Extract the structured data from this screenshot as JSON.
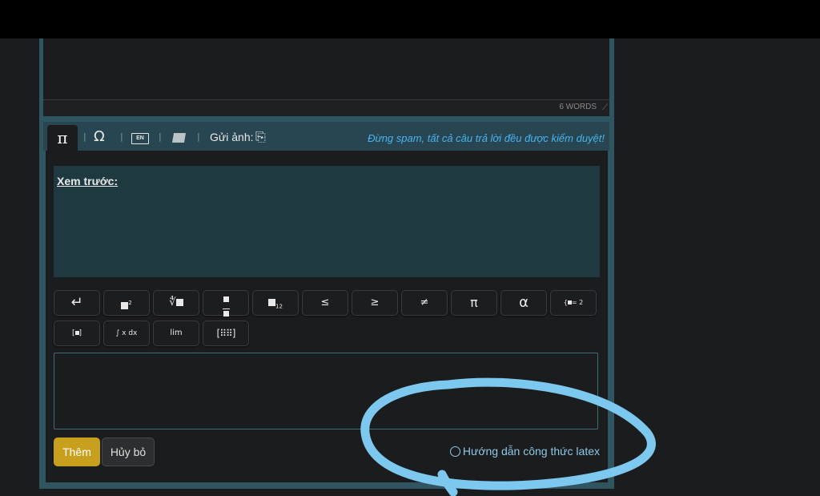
{
  "editor": {
    "word_count": "6 WORDS"
  },
  "toolbar": {
    "math_tab": "π",
    "omega": "Ω",
    "en_icon": "EN",
    "upload_label": "Gửi ảnh:",
    "notice": "Đừng spam, tất cả câu trả lời đều được kiểm duyệt!"
  },
  "preview": {
    "label": "Xem trước:"
  },
  "math_buttons": {
    "enter": "↵",
    "le": "≤",
    "ge": "≥",
    "ne": "≠",
    "pi": "π",
    "alpha": "α",
    "power_sup": "2",
    "sub": "12",
    "root": "∜",
    "integral": "∫ x dx",
    "lim": "lim",
    "sys_eq": "= 2"
  },
  "actions": {
    "add": "Thêm",
    "cancel": "Hủy bỏ",
    "latex_guide": "Hướng dẫn công thức latex"
  },
  "colors": {
    "accent": "#c8a01e",
    "frame": "#2f5560",
    "link": "#4ab2f0",
    "annotation": "#7cc8ef"
  }
}
